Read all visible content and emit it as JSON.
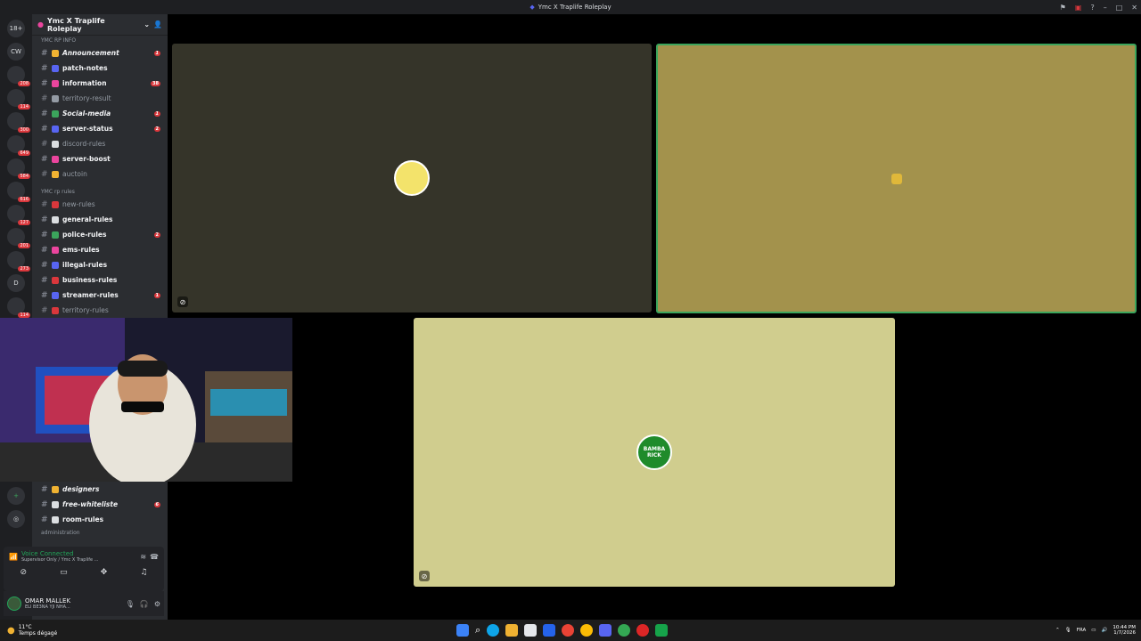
{
  "window": {
    "title": "Ymc X Traplife Roleplay"
  },
  "servers": [
    {
      "label": "18+",
      "badge": ""
    },
    {
      "label": "CW",
      "badge": ""
    },
    {
      "label": "",
      "badge": "208"
    },
    {
      "label": "",
      "badge": "114"
    },
    {
      "label": "",
      "badge": "300"
    },
    {
      "label": "",
      "badge": "649"
    },
    {
      "label": "",
      "badge": "584"
    },
    {
      "label": "",
      "badge": "616"
    },
    {
      "label": "",
      "badge": "127"
    },
    {
      "label": "",
      "badge": "201"
    },
    {
      "label": "",
      "badge": "273"
    },
    {
      "label": "D",
      "badge": ""
    },
    {
      "label": "",
      "badge": "114"
    }
  ],
  "guild": {
    "name": "Ymc X Traplife Roleplay"
  },
  "categories": {
    "info": "YMC RP INFO",
    "rules": "YMC rp rules",
    "admin": "administration"
  },
  "info_channels": [
    {
      "name": "Announcement",
      "unread": true,
      "italic": true,
      "count": "1",
      "color": "#f0b232"
    },
    {
      "name": "patch-notes",
      "unread": true,
      "italic": false,
      "count": "",
      "color": "#5865f2"
    },
    {
      "name": "information",
      "unread": true,
      "italic": false,
      "count": "38",
      "color": "#eb459e"
    },
    {
      "name": "territory-result",
      "unread": false,
      "italic": false,
      "count": "",
      "color": "#949ba4"
    },
    {
      "name": "Social-media",
      "unread": true,
      "italic": true,
      "count": "1",
      "color": "#3ba55c"
    },
    {
      "name": "server-status",
      "unread": true,
      "italic": false,
      "count": "2",
      "color": "#5865f2"
    },
    {
      "name": "discord-rules",
      "unread": false,
      "italic": false,
      "count": "",
      "color": "#dbdee1"
    },
    {
      "name": "server-boost",
      "unread": true,
      "italic": false,
      "count": "",
      "color": "#eb459e"
    },
    {
      "name": "auctoin",
      "unread": false,
      "italic": false,
      "count": "",
      "color": "#f0b232"
    }
  ],
  "rules_channels": [
    {
      "name": "new-rules",
      "unread": false,
      "italic": false,
      "count": "",
      "color": "#da373c"
    },
    {
      "name": "general-rules",
      "unread": true,
      "italic": false,
      "count": "",
      "color": "#dbdee1"
    },
    {
      "name": "police-rules",
      "unread": true,
      "italic": false,
      "count": "2",
      "color": "#3ba55c"
    },
    {
      "name": "ems-rules",
      "unread": true,
      "italic": false,
      "count": "",
      "color": "#eb459e"
    },
    {
      "name": "illegal-rules",
      "unread": true,
      "italic": false,
      "count": "",
      "color": "#5865f2"
    },
    {
      "name": "business-rules",
      "unread": true,
      "italic": false,
      "count": "",
      "color": "#da373c"
    },
    {
      "name": "streamer-rules",
      "unread": true,
      "italic": false,
      "count": "1",
      "color": "#5865f2"
    },
    {
      "name": "territory-rules",
      "unread": false,
      "italic": false,
      "count": "",
      "color": "#da373c"
    }
  ],
  "lower_channels": [
    {
      "name": "designers",
      "unread": true,
      "italic": true,
      "count": "",
      "color": "#f0b232"
    },
    {
      "name": "free-whiteliste",
      "unread": true,
      "italic": true,
      "count": "6",
      "color": "#dbdee1"
    },
    {
      "name": "room-rules",
      "unread": true,
      "italic": false,
      "count": "",
      "color": "#dbdee1"
    }
  ],
  "voice": {
    "status": "Voice Connected",
    "channel": "Supervisor Only / Ymc X Traplife ..."
  },
  "user": {
    "name": "OMAR MALLEK",
    "status": "ELI BE3NA YJI NHA..."
  },
  "tiles": [
    {
      "bg": "#353429",
      "border": "#353429",
      "avatar_bg": "#f3e36b"
    },
    {
      "bg": "#a3924c",
      "border": "#3ba55c",
      "avatar_bg": "#e0b83a"
    },
    {
      "bg": "#d0cd8e",
      "border": "#d0cd8e",
      "avatar_bg": "#1f8b2b",
      "avatar_text": "BAMBA RICK"
    }
  ],
  "taskbar": {
    "weather_temp": "11°C",
    "weather_text": "Temps dégagé",
    "lang": "FRA",
    "time": "10:44 PM",
    "date": "1/7/2026"
  }
}
